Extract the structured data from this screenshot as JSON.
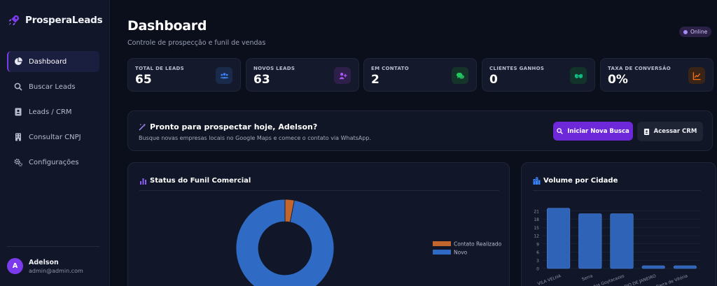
{
  "app": {
    "brand": "ProsperaLeads"
  },
  "sidebar": {
    "items": [
      {
        "label": "Dashboard",
        "icon": "pie-chart-icon",
        "active": true
      },
      {
        "label": "Buscar Leads",
        "icon": "search-icon"
      },
      {
        "label": "Leads / CRM",
        "icon": "address-book-icon"
      },
      {
        "label": "Consultar CNPJ",
        "icon": "building-icon"
      },
      {
        "label": "Configurações",
        "icon": "gears-icon"
      }
    ],
    "user": {
      "initial": "A",
      "name": "Adelson",
      "email": "admin@admin.com"
    }
  },
  "header": {
    "title": "Dashboard",
    "subtitle": "Controle de prospecção e funil de vendas",
    "status": "Online"
  },
  "stats": [
    {
      "label": "TOTAL DE LEADS",
      "value": "65",
      "icon": "users-icon",
      "color": "#3b82f6"
    },
    {
      "label": "NOVOS LEADS",
      "value": "63",
      "icon": "user-plus-icon",
      "color": "#a855f7"
    },
    {
      "label": "EM CONTATO",
      "value": "2",
      "icon": "comments-icon",
      "color": "#22c55e"
    },
    {
      "label": "CLIENTES GANHOS",
      "value": "0",
      "icon": "handshake-icon",
      "color": "#10b981"
    },
    {
      "label": "TAXA DE CONVERSÃO",
      "value": "0%",
      "icon": "chart-line-icon",
      "color": "#f97316"
    }
  ],
  "welcome": {
    "title": "Pronto para prospectar hoje, Adelson?",
    "subtitle": "Busque novas empresas locais no Google Maps e comece o contato via WhatsApp.",
    "primary_button": "Iniciar Nova Busca",
    "secondary_button": "Acessar CRM"
  },
  "funnel": {
    "title": "Status do Funil Comercial",
    "chart_data": {
      "type": "pie",
      "labels": [
        "Contato Realizado",
        "Novo"
      ],
      "values": [
        2,
        63
      ],
      "colors": [
        "#c2662d",
        "#2f6bc4"
      ],
      "legend": "right"
    }
  },
  "city": {
    "title": "Volume por Cidade",
    "chart_data": {
      "type": "bar",
      "categories": [
        "VILA VELHA",
        "Serra",
        "Campos dos Goytacazes",
        "RIO DE JANEIRO",
        "Barra do Jucu Barra de Vitória"
      ],
      "values": [
        22,
        20,
        20,
        1,
        1
      ],
      "y_ticks": [
        "0",
        "3",
        "6",
        "9",
        "12",
        "15",
        "18",
        "21"
      ],
      "ylim": [
        0,
        24
      ],
      "color": "#2f63b8"
    }
  }
}
